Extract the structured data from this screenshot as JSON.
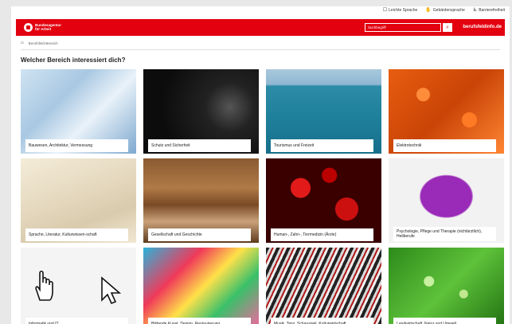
{
  "utility": {
    "items": [
      {
        "icon": "speech-icon",
        "label": "Leichte Sprache"
      },
      {
        "icon": "hand-sign-icon",
        "label": "Gebärdensprache"
      },
      {
        "icon": "accessibility-icon",
        "label": "Barrierefreiheit"
      }
    ]
  },
  "header": {
    "logo_line1": "Bundesagentur",
    "logo_line2": "für Arbeit",
    "search_placeholder": "Suchbegriff",
    "search_icon": "search-icon",
    "brand_url": "berufsfeldinfo.de"
  },
  "breadcrumb": {
    "home_icon": "home-icon",
    "current": "Berufsfeld-Bereich"
  },
  "page": {
    "title": "Welcher Bereich interessiert dich?"
  },
  "tiles": [
    {
      "label": "Bauwesen, Architektur, Vermessung"
    },
    {
      "label": "Schutz und Sicherheit"
    },
    {
      "label": "Tourismus und Freizeit"
    },
    {
      "label": "Elektrotechnik"
    },
    {
      "label": "Sprache, Literatur, Kulturwissen-schaft"
    },
    {
      "label": "Gesellschaft und Geschichte"
    },
    {
      "label": "Human-, Zahn-, Tiermedizin (Ärzte)"
    },
    {
      "label": "Psychologie, Pflege und Therapie (nichtärztlich), Heilberufe"
    },
    {
      "label": "Informatik und IT"
    },
    {
      "label": "Bildende Kunst, Design, Restaurierung"
    },
    {
      "label": "Musik, Tanz, Schauspiel, Kulturwirtschaft"
    },
    {
      "label": "Landwirtschaft, Natur und Umwelt"
    }
  ],
  "colors": {
    "brand_red": "#e3000f"
  }
}
